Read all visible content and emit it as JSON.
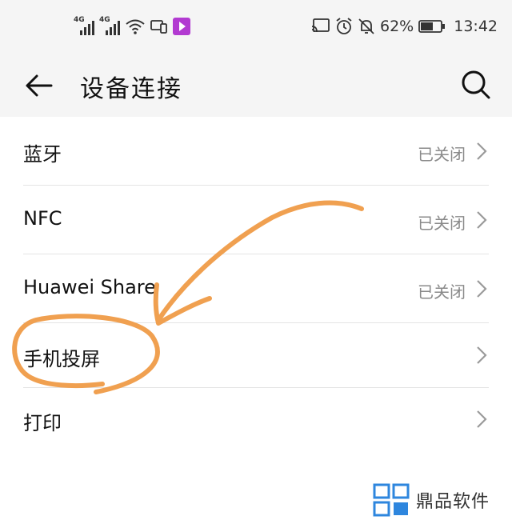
{
  "statusbar": {
    "network1": "4G",
    "network2": "4G",
    "battery_percent": "62%",
    "time": "13:42",
    "icons": [
      "cellular-signal-icon",
      "cellular-signal-icon",
      "wifi-icon",
      "multi-screen-icon",
      "video-app-icon",
      "cast-icon",
      "alarm-icon",
      "do-not-disturb-icon",
      "battery-icon"
    ]
  },
  "header": {
    "title": "设备连接",
    "back_icon": "back-arrow-icon",
    "search_icon": "search-icon"
  },
  "settings": [
    {
      "label": "蓝牙",
      "status": "已关闭"
    },
    {
      "label": "NFC",
      "status": "已关闭"
    },
    {
      "label": "Huawei Share",
      "status": "已关闭"
    },
    {
      "label": "手机投屏",
      "status": ""
    },
    {
      "label": "打印",
      "status": ""
    }
  ],
  "watermark": {
    "text": "鼎品软件",
    "color": "#2e86de"
  },
  "annotation_color": "#f0a050"
}
